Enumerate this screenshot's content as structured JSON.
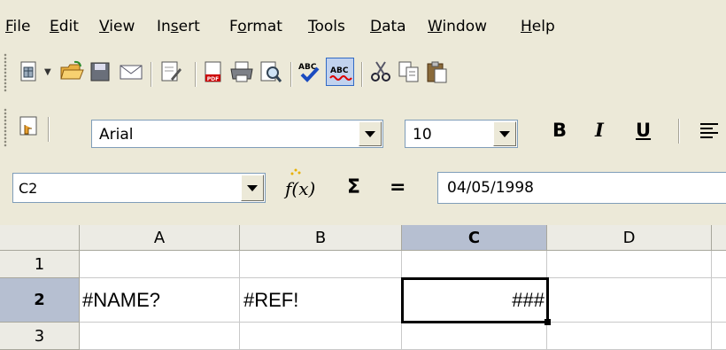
{
  "menu": {
    "file": "File",
    "edit": "Edit",
    "view": "View",
    "insert": "Insert",
    "format": "Format",
    "tools": "Tools",
    "data": "Data",
    "window": "Window",
    "help": "Help"
  },
  "format_toolbar": {
    "font_name": "Arial",
    "font_size": "10",
    "bold": "B",
    "italic": "I",
    "underline": "U"
  },
  "formula_bar": {
    "name_box": "C2",
    "function_label": "f(x)",
    "sum_label": "Σ",
    "equals_label": "=",
    "contents": "04/05/1998"
  },
  "sheet": {
    "columns": [
      "A",
      "B",
      "C",
      "D"
    ],
    "rows": [
      "1",
      "2",
      "3"
    ],
    "cells": {
      "A2": "#NAME?",
      "B2": "#REF!",
      "C2": "###"
    },
    "selected_cell": "C2"
  },
  "colors": {
    "chrome": "#ece9d8",
    "header_bg": "#ecebe4",
    "header_selected": "#b6bfd1",
    "grid_line": "#c9c9c9"
  }
}
